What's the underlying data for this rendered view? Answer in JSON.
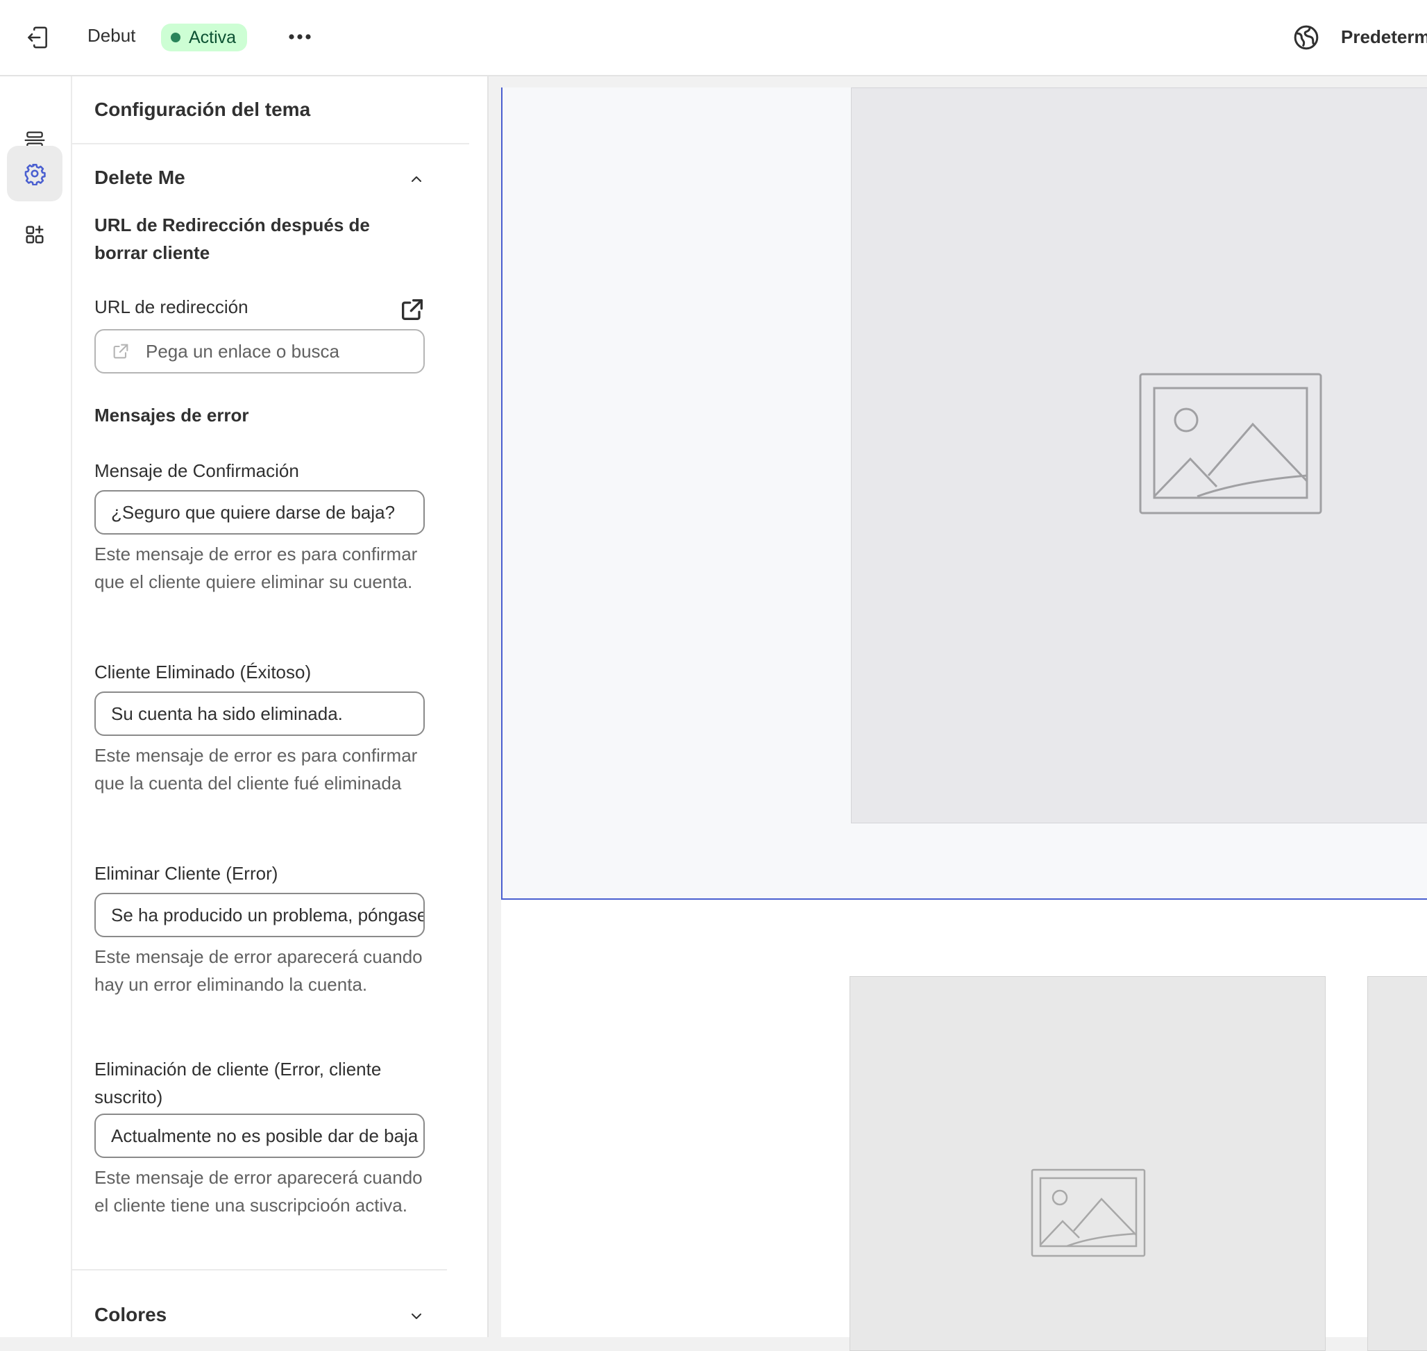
{
  "topbar": {
    "theme_name": "Debut",
    "status_badge": "Activa",
    "language": "Predeterminado"
  },
  "panel": {
    "title": "Configuración del tema",
    "section_title": "Delete Me",
    "redirect_heading": "URL de Redirección después de borrar cliente",
    "redirect_label": "URL de redirección",
    "redirect_placeholder": "Pega un enlace o busca",
    "errors_heading": "Mensajes de error",
    "fields": [
      {
        "label": "Mensaje de Confirmación",
        "value": "¿Seguro que quiere darse de baja?",
        "help": "Este mensaje de error es para confirmar que el cliente quiere eliminar su cuenta."
      },
      {
        "label": "Cliente Eliminado (Éxitoso)",
        "value": "Su cuenta ha sido eliminada.",
        "help": "Este mensaje de error es para confirmar que la cuenta del cliente fué eliminada"
      },
      {
        "label": "Eliminar Cliente (Error)",
        "value": "Se ha producido un problema, póngase en contacto",
        "help": "Este mensaje de error aparecerá cuando hay un error eliminando la cuenta."
      },
      {
        "label": "Eliminación de cliente (Error, cliente suscrito)",
        "value": "Actualmente no es posible dar de baja",
        "help": "Este mensaje de error aparecerá cuando el cliente tiene una suscripcioón activa."
      }
    ],
    "colors_section": "Colores"
  },
  "icons": {
    "exit": "exit-icon",
    "more": "more-horizontal-icon",
    "globe": "globe-icon",
    "sections": "sections-icon",
    "settings": "gear-icon",
    "apps": "apps-add-icon",
    "external": "external-link-icon",
    "chevron_up": "chevron-up-icon",
    "chevron_down": "chevron-down-icon",
    "image_placeholder": "image-placeholder-icon"
  },
  "colors": {
    "accent": "#4a5fd0",
    "badge_bg": "#cdfed4",
    "badge_dot": "#29845a"
  }
}
